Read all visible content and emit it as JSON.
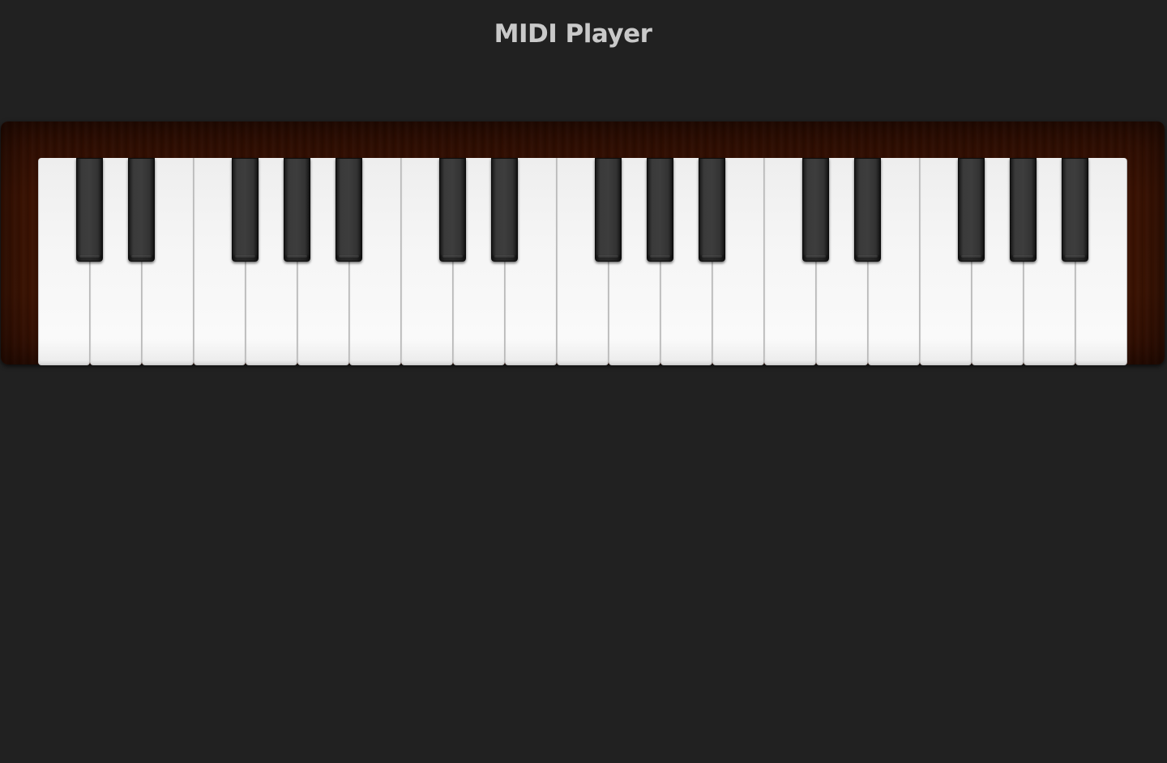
{
  "header": {
    "title": "MIDI Player"
  },
  "keyboard": {
    "white_keys": [
      "C",
      "D",
      "E",
      "F",
      "G",
      "A",
      "B",
      "C",
      "D",
      "E",
      "F",
      "G",
      "A",
      "B",
      "C",
      "D",
      "E",
      "F",
      "G",
      "A",
      "B"
    ],
    "black_keys": [
      "C#",
      "D#",
      "F#",
      "G#",
      "A#",
      "C#",
      "D#",
      "F#",
      "G#",
      "A#",
      "C#",
      "D#",
      "F#",
      "G#",
      "A#"
    ],
    "colors": {
      "background": "#212121",
      "case_wood": "#3a1203",
      "white_key": "#f5f5f5",
      "black_key": "#333333",
      "title_text": "#c9c9c9"
    }
  }
}
